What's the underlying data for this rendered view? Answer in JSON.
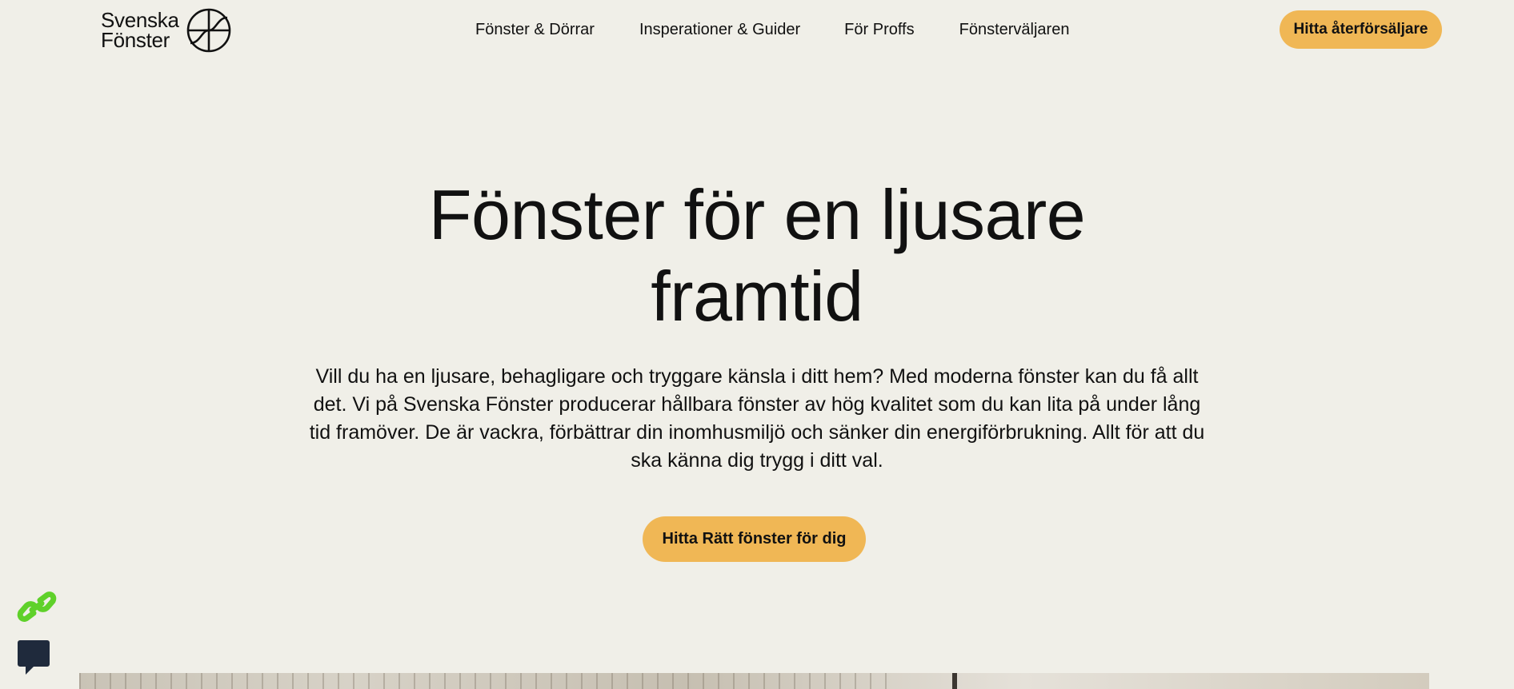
{
  "header": {
    "logo": {
      "line1": "Svenska",
      "line2": "Fönster"
    },
    "nav": [
      {
        "label": "Fönster & Dörrar"
      },
      {
        "label": "Insperationer & Guider"
      },
      {
        "label": "För Proffs"
      },
      {
        "label": "Fönsterväljaren"
      }
    ],
    "dealer_button": "Hitta återförsäljare"
  },
  "hero": {
    "title_line1": "Fönster för en ljusare",
    "title_line2": "framtid",
    "text_line1": "Vill du ha en ljusare, behagligare och tryggare känsla i ditt hem? Med moderna fönster kan du få allt",
    "text_line2": "det. Vi på Svenska Fönster producerar hållbara fönster av hög kvalitet som du kan lita på under lång",
    "text_line3": "tid framöver. De är vackra, förbättrar din inomhusmiljö och sänker din energiförbrukning. Allt för att du",
    "text_line4": "ska känna dig trygg i ditt val.",
    "cta_button": "Hitta Rätt fönster för dig"
  },
  "widgets": {
    "link_icon": "link-icon",
    "chat_icon": "chat-icon"
  },
  "colors": {
    "background": "#f0efe8",
    "accent": "#f0b755",
    "link_widget": "#5fd12a",
    "chat_widget": "#1f2a3c"
  }
}
